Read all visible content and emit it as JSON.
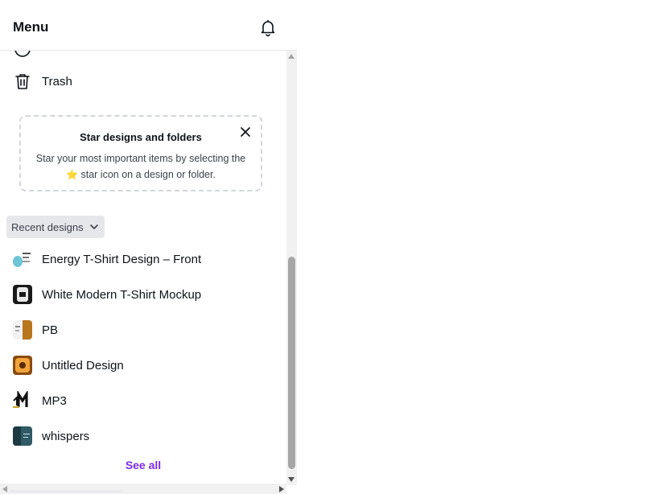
{
  "header": {
    "title": "Menu",
    "bell_icon": "bell-icon"
  },
  "nav": {
    "partial_item_icon": "circle-icon",
    "trash": {
      "label": "Trash",
      "icon": "trash-icon"
    }
  },
  "star_card": {
    "title": "Star designs and folders",
    "text_before": "Star your most important items by selecting the",
    "star_icon": "star-icon",
    "text_after": "star icon on a design or folder.",
    "close_icon": "close-icon"
  },
  "recent": {
    "section_label": "Recent designs",
    "chevron_icon": "chevron-down-icon",
    "items": [
      {
        "label": "Energy T-Shirt Design – Front",
        "thumb_colors": [
          "#ffffff",
          "#6ec5d6"
        ]
      },
      {
        "label": "White Modern T-Shirt Mockup",
        "thumb_colors": [
          "#1a1a1a",
          "#e8e8e8"
        ]
      },
      {
        "label": "PB",
        "thumb_colors": [
          "#f2f2f2",
          "#b8761c"
        ]
      },
      {
        "label": "Untitled Design",
        "thumb_colors": [
          "#8a4a0f",
          "#f2a33a"
        ]
      },
      {
        "label": "MP3",
        "thumb_colors": [
          "#ffffff",
          "#111111"
        ]
      },
      {
        "label": "whispers",
        "thumb_colors": [
          "#2f5a66",
          "#1c3a44"
        ]
      }
    ],
    "see_all_label": "See all"
  },
  "colors": {
    "accent": "#7d2ae8",
    "star": "#f5c400",
    "text": "#0e1318"
  }
}
